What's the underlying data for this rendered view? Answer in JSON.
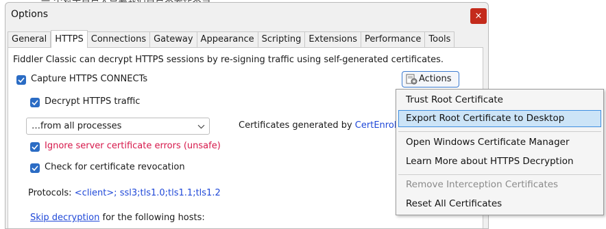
{
  "background": {
    "text": "一 个对于自己人只要我们自己不去作不当"
  },
  "window": {
    "title": "Options",
    "close_glyph": "×"
  },
  "tabs": [
    "General",
    "HTTPS",
    "Connections",
    "Gateway",
    "Appearance",
    "Scripting",
    "Extensions",
    "Performance",
    "Tools"
  ],
  "https": {
    "description": "Fiddler Classic can decrypt HTTPS sessions by re-signing traffic using self-generated certificates.",
    "capture_label": "Capture HTTPS CONNECTs",
    "decrypt_label": "Decrypt HTTPS traffic",
    "process_filter_value": "…from all processes",
    "cert_prefix": "Certificates generated by",
    "cert_link": "CertEnroll",
    "ignore_errors_label": "Ignore server certificate errors (unsafe)",
    "revocation_label": "Check for certificate revocation",
    "protocols_prefix": "Protocols:",
    "protocols_value": "<client>; ssl3;tls1.0;tls1.1;tls1.2",
    "skip_link": "Skip decryption",
    "skip_suffix": "for the following hosts:",
    "actions_label": "Actions"
  },
  "actions_menu": {
    "items": [
      {
        "label": "Trust Root Certificate"
      },
      {
        "label": "Export Root Certificate to Desktop"
      },
      {
        "label": "Open Windows Certificate Manager"
      },
      {
        "label": "Learn More about HTTPS Decryption"
      },
      {
        "label": "Remove Interception Certificates"
      },
      {
        "label": "Reset All Certificates"
      }
    ]
  },
  "colors": {
    "accent": "#2b6cc4",
    "link": "#1f48d8",
    "warning": "#d6174a",
    "close": "#c42b1c",
    "menu_highlight": "#cce4f7"
  }
}
